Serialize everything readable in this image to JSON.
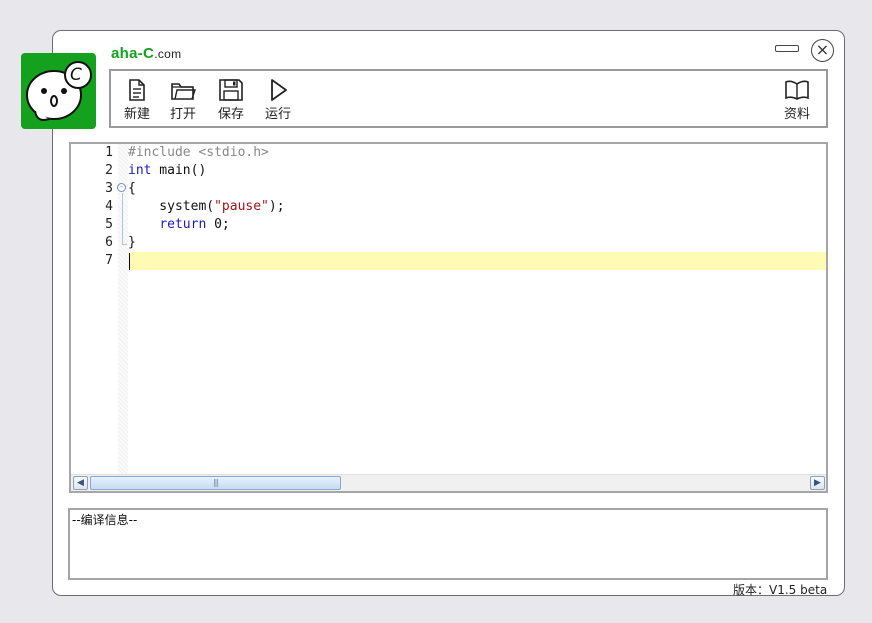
{
  "app": {
    "site_name": "aha-C",
    "site_suffix": ".com",
    "logo_letter": "C",
    "brand_color": "#14a11e"
  },
  "window_controls": {
    "minimize_icon": "minimize-icon",
    "close_symbol": "×"
  },
  "toolbar": {
    "new_label": "新建",
    "open_label": "打开",
    "save_label": "保存",
    "run_label": "运行",
    "docs_label": "资料"
  },
  "editor": {
    "line_numbers": [
      "1",
      "2",
      "3",
      "4",
      "5",
      "6",
      "7"
    ],
    "current_line": 7,
    "lines": [
      [
        {
          "t": "#include <stdio.h>",
          "k": "pre"
        }
      ],
      [
        {
          "t": "int",
          "k": "kw"
        },
        {
          "t": " main()",
          "k": ""
        }
      ],
      [
        {
          "t": "{",
          "k": ""
        }
      ],
      [
        {
          "t": "    system(",
          "k": ""
        },
        {
          "t": "\"pause\"",
          "k": "str"
        },
        {
          "t": ");",
          "k": ""
        }
      ],
      [
        {
          "t": "    ",
          "k": ""
        },
        {
          "t": "return",
          "k": "kw"
        },
        {
          "t": " 0;",
          "k": ""
        }
      ],
      [
        {
          "t": "}",
          "k": ""
        }
      ],
      [
        {
          "t": "",
          "k": ""
        }
      ]
    ],
    "fold_symbol": "⊖",
    "scroll_thumb_grip": "|||"
  },
  "output": {
    "title": "--编译信息--"
  },
  "footer": {
    "version": "版本：V1.5 beta"
  }
}
